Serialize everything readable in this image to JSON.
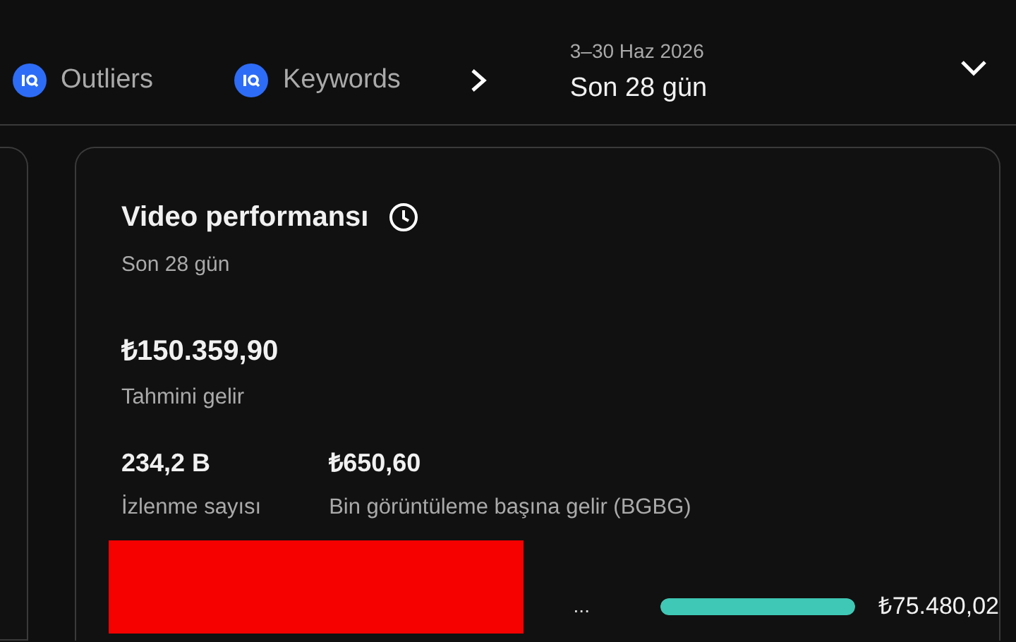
{
  "top_bar": {
    "chips": [
      {
        "label": "Outliers"
      },
      {
        "label": "Keywords"
      }
    ],
    "date_range": {
      "dates": "3–30 Haz 2026",
      "period": "Son 28 gün"
    }
  },
  "card": {
    "title": "Video performansı",
    "subtitle": "Son 28 gün",
    "revenue": {
      "value": "₺150.359,90",
      "label": "Tahmini gelir"
    },
    "stats": [
      {
        "value": "234,2 B",
        "label": "İzlenme sayısı"
      },
      {
        "value": "₺650,60",
        "label": "Bin görüntüleme başına gelir (BGBG)"
      }
    ],
    "top_video": {
      "title_tail": "...",
      "level": 1,
      "amount": "₺75.480,02",
      "redacted": true
    }
  }
}
